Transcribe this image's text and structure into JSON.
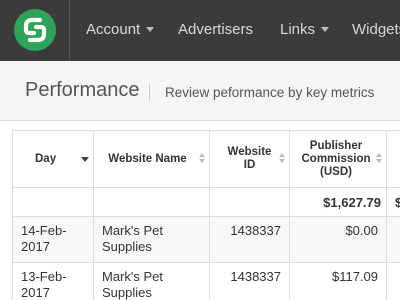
{
  "nav": {
    "logo_alt": "CJ",
    "items": [
      {
        "label": "Account",
        "has_dropdown": true
      },
      {
        "label": "Advertisers",
        "has_dropdown": false
      },
      {
        "label": "Links",
        "has_dropdown": true
      },
      {
        "label": "Widgets",
        "has_dropdown": false
      }
    ]
  },
  "header": {
    "title": "Performance",
    "subtitle": "Review peformance by key metrics"
  },
  "table": {
    "columns": [
      {
        "label": "Day",
        "sort": "desc"
      },
      {
        "label": "Website Name",
        "sort": "none"
      },
      {
        "label": "Website ID",
        "sort": "none"
      },
      {
        "label": "Publisher Commission (USD)",
        "sort": "none"
      },
      {
        "label": "",
        "sort": "none"
      }
    ],
    "totals": [
      "",
      "",
      "",
      "$1,627.79",
      "$"
    ],
    "rows": [
      {
        "day": "14-Feb-2017",
        "website_name": "Mark's Pet Supplies",
        "website_id": "1438337",
        "commission": "$0.00"
      },
      {
        "day": "13-Feb-2017",
        "website_name": "Mark's Pet Supplies",
        "website_id": "1438337",
        "commission": "$117.09"
      }
    ]
  },
  "colors": {
    "topbar": "#3b3b3b",
    "brand_green": "#2fa35a",
    "header_bg": "#f5f5f5",
    "alt_row": "#f7f7f7"
  }
}
